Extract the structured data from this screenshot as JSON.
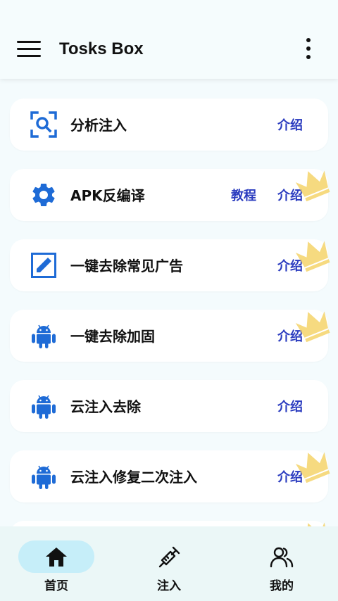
{
  "app": {
    "title": "Tosks Box"
  },
  "icons": {
    "menu": "menu-icon",
    "more": "more-vert-icon",
    "crown": "crown-icon"
  },
  "colors": {
    "accent": "#1e6bd6",
    "link": "#2a3bbf",
    "crown": "#f5d46a",
    "nav_active": "#c6eef9"
  },
  "tools": [
    {
      "label": "分析注入",
      "icon": "scan-search-icon",
      "links": [
        "介绍"
      ],
      "crown": false
    },
    {
      "label": "APK反编译",
      "icon": "gear-icon",
      "links": [
        "教程",
        "介绍"
      ],
      "crown": true
    },
    {
      "label": "一键去除常见广告",
      "icon": "edit-square-icon",
      "links": [
        "介绍"
      ],
      "crown": true
    },
    {
      "label": "一键去除加固",
      "icon": "android-icon",
      "links": [
        "介绍"
      ],
      "crown": true
    },
    {
      "label": "云注入去除",
      "icon": "android-icon",
      "links": [
        "介绍"
      ],
      "crown": false
    },
    {
      "label": "云注入修复二次注入",
      "icon": "android-icon",
      "links": [
        "介绍"
      ],
      "crown": true
    }
  ],
  "nav": {
    "items": [
      {
        "label": "首页",
        "icon": "home-icon",
        "active": true
      },
      {
        "label": "注入",
        "icon": "syringe-icon",
        "active": false
      },
      {
        "label": "我的",
        "icon": "people-icon",
        "active": false
      }
    ]
  }
}
